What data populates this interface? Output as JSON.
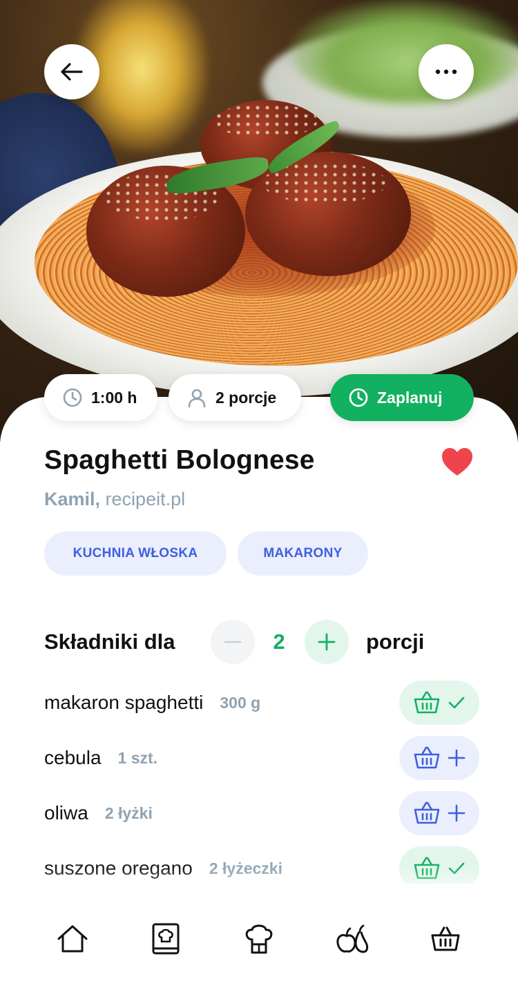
{
  "hero": {
    "image": "spaghetti-meatballs-photo"
  },
  "header": {
    "back_icon": "arrow-left-icon",
    "more_icon": "more-horizontal-icon"
  },
  "meta": {
    "time": "1:00 h",
    "servings": "2 porcje",
    "plan_label": "Zaplanuj"
  },
  "recipe": {
    "title": "Spaghetti Bolognese",
    "author_name": "Kamil,",
    "author_source": "recipeit.pl",
    "favorite": true,
    "tags": [
      "KUCHNIA WŁOSKA",
      "MAKARONY"
    ]
  },
  "ingredients": {
    "heading_prefix": "Składniki dla",
    "servings_count": "2",
    "heading_suffix": "porcji",
    "items": [
      {
        "name": "makaron spaghetti",
        "qty": "300 g",
        "in_basket": true
      },
      {
        "name": "cebula",
        "qty": "1 szt.",
        "in_basket": false
      },
      {
        "name": "oliwa",
        "qty": "2 łyżki",
        "in_basket": false
      },
      {
        "name": "suszone oregano",
        "qty": "2 łyżeczki",
        "in_basket": true
      }
    ]
  },
  "nav": {
    "items": [
      "home-icon",
      "recipe-book-icon",
      "chef-hat-icon",
      "fruit-icon",
      "basket-icon"
    ]
  },
  "colors": {
    "accent_green": "#12b061",
    "accent_blue": "#3d5fe0",
    "tag_bg": "#ebeefd",
    "muted_text": "#8ea2b2",
    "heart_red": "#f0444c"
  }
}
